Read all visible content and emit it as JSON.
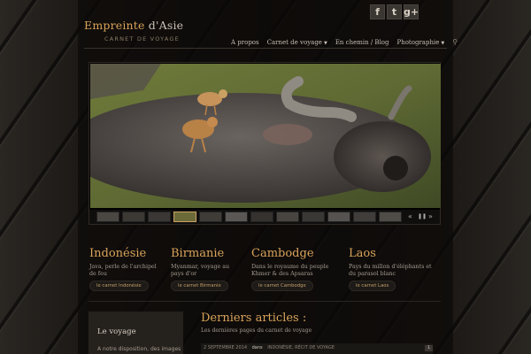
{
  "logo": {
    "main": "Empreinte",
    "accent": " d'Asie",
    "subtitle": "CARNET DE VOYAGE"
  },
  "social": [
    {
      "icon": "facebook-icon",
      "glyph": "f"
    },
    {
      "icon": "twitter-icon",
      "glyph": "t"
    },
    {
      "icon": "googleplus-icon",
      "glyph": "g+"
    }
  ],
  "nav": {
    "items": [
      {
        "label": "A propos",
        "dropdown": false
      },
      {
        "label": "Carnet de voyage",
        "dropdown": true
      },
      {
        "label": "En chemin / Blog",
        "dropdown": false
      },
      {
        "label": "Photographie",
        "dropdown": true
      }
    ],
    "search_icon": "search-icon"
  },
  "slider": {
    "controls": {
      "prev": "«",
      "pause": "❚❚",
      "next": "»"
    }
  },
  "countries": [
    {
      "title": "Indonésie",
      "desc": "Java, perle de l'archipel de feu",
      "button": "le carnet Indonésie"
    },
    {
      "title": "Birmanie",
      "desc": "Myanmar, voyage au pays d'or",
      "button": "le carnet Birmanie"
    },
    {
      "title": "Cambodge",
      "desc": "Dans le royaume du peuple Khmer & des Apsaras",
      "button": "le carnet Cambodge"
    },
    {
      "title": "Laos",
      "desc": "Pays du millon d'éléphants et du parasol blanc",
      "button": "le carnet Laos"
    }
  ],
  "sidebar": {
    "heading": "Le voyage",
    "text": "A notre disposition, des images"
  },
  "articles": {
    "title": "Derniers articles :",
    "subtitle": "Les dernières pages du carnet de voyage",
    "meta": {
      "date": "2 SEPTEMBRE 2014",
      "dans": "dans",
      "category": "INDONÉSIE, RÉCIT DE VOYAGE",
      "comments": "1"
    }
  }
}
